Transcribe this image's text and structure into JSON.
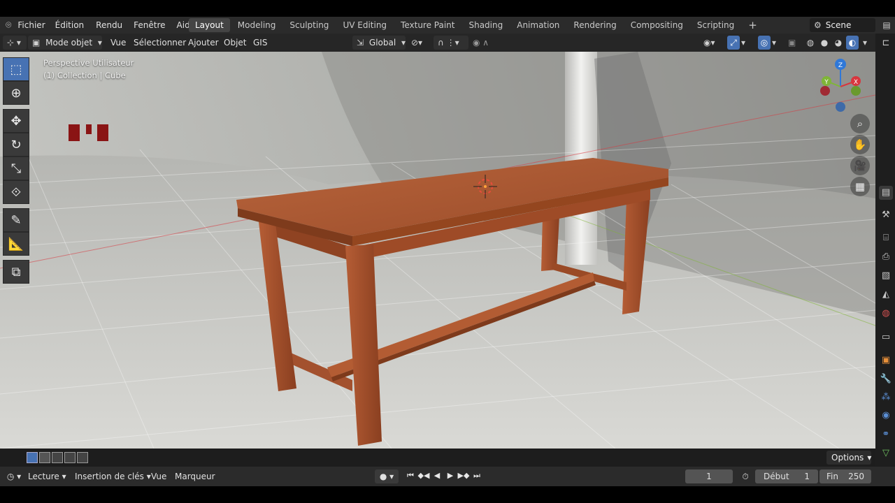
{
  "app_menu": [
    "Fichier",
    "Édition",
    "Rendu",
    "Fenêtre",
    "Aide"
  ],
  "workspaces": [
    "Layout",
    "Modeling",
    "Sculpting",
    "UV Editing",
    "Texture Paint",
    "Shading",
    "Animation",
    "Rendering",
    "Compositing",
    "Scripting"
  ],
  "active_workspace": "Layout",
  "add_workspace": "+",
  "scene_name": "Scene",
  "header": {
    "mode": "Mode objet",
    "menus": [
      "Vue",
      "Sélectionner",
      "Ajouter",
      "Objet",
      "GIS"
    ],
    "orientation": "Global"
  },
  "viewport": {
    "view_name": "Perspective Utilisateur",
    "collection_info": "(1) Collection | Cube",
    "gizmo": {
      "x_label": "X",
      "y_label": "Y",
      "z_label": "Z"
    }
  },
  "toolbar": {
    "tools": [
      "select-box",
      "cursor",
      "move",
      "rotate",
      "scale",
      "transform",
      "annotate",
      "measure",
      "add-cube"
    ]
  },
  "footer": {
    "options_label": "Options"
  },
  "timeline": {
    "playback_label": "Lecture",
    "keying_label": "Insertion de clés",
    "view_label": "Vue",
    "marker_label": "Marqueur",
    "current_frame": "1",
    "start_label": "Début",
    "start_frame": "1",
    "end_label": "Fin",
    "end_frame": "250"
  },
  "colors": {
    "accent": "#4772b3",
    "table_wood": "#a3512e",
    "x_axis": "#d8363e",
    "y_axis": "#7fb537",
    "z_axis": "#2f78d8",
    "bg_dark": "#2b2b2b"
  }
}
